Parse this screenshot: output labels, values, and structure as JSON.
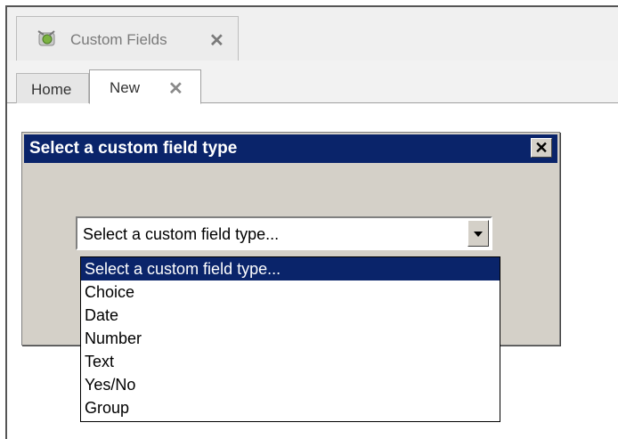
{
  "doc_tab": {
    "label": "Custom Fields",
    "close_glyph": "✕",
    "icon": "custom-fields-icon"
  },
  "inner_tabs": [
    {
      "label": "Home"
    },
    {
      "label": "New",
      "close_glyph": "✕"
    }
  ],
  "dialog": {
    "title": "Select a custom field type",
    "close_glyph": "✕",
    "select": {
      "value": "Select a custom field type...",
      "options": [
        "Select a custom field type...",
        "Choice",
        "Date",
        "Number",
        "Text",
        "Yes/No",
        "Group"
      ],
      "selected_index": 0
    }
  },
  "colors": {
    "title_bar": "#0a246a",
    "dialog_bg": "#d4d0c8",
    "highlight": "#0a246a"
  }
}
